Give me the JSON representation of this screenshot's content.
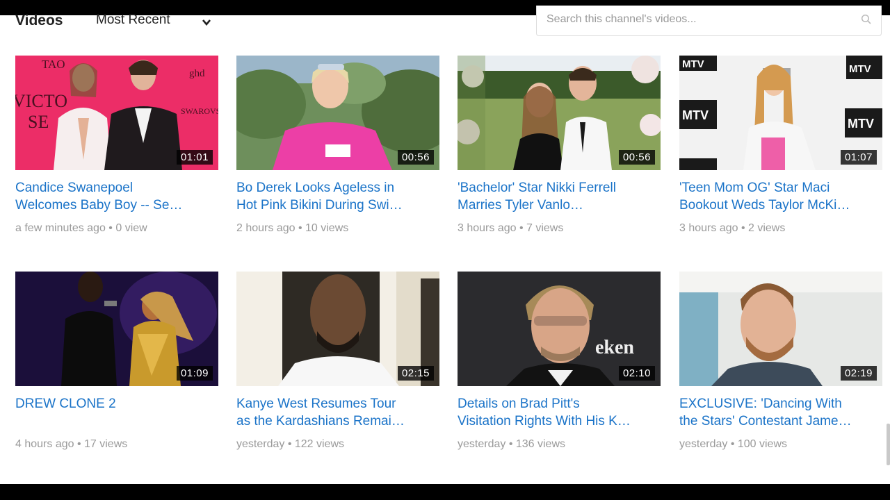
{
  "header": {
    "section_title": "Videos",
    "sort_label": "Most Recent",
    "search_placeholder": "Search this channel's videos..."
  },
  "videos": [
    {
      "title_line1": "Candice Swanepoel",
      "title_line2": "Welcomes Baby Boy -- Se…",
      "meta": "a few minutes ago • 0 view",
      "duration": "01:01"
    },
    {
      "title_line1": "Bo Derek Looks Ageless in",
      "title_line2": "Hot Pink Bikini During Swi…",
      "meta": "2 hours ago • 10 views",
      "duration": "00:56"
    },
    {
      "title_line1": "'Bachelor' Star Nikki Ferrell",
      "title_line2": "Marries Tyler Vanlo…",
      "meta": "3 hours ago • 7 views",
      "duration": "00:56"
    },
    {
      "title_line1": "'Teen Mom OG' Star Maci",
      "title_line2": "Bookout Weds Taylor McKi…",
      "meta": "3 hours ago • 2 views",
      "duration": "01:07"
    },
    {
      "title_line1": "DREW CLONE 2",
      "title_line2": "",
      "meta": "4 hours ago • 17 views",
      "duration": "01:09"
    },
    {
      "title_line1": "Kanye West Resumes Tour",
      "title_line2": "as the Kardashians Remai…",
      "meta": "yesterday • 122 views",
      "duration": "02:15"
    },
    {
      "title_line1": "Details on Brad Pitt's",
      "title_line2": "Visitation Rights With His K…",
      "meta": "yesterday • 136 views",
      "duration": "02:10"
    },
    {
      "title_line1": "EXCLUSIVE: 'Dancing With",
      "title_line2": "the Stars' Contestant Jame…",
      "meta": "yesterday • 100 views",
      "duration": "02:19"
    }
  ],
  "thumb_text": {
    "t1_tao": "TAO",
    "t1_victoria": "VICTO",
    "t1_secret": "SE",
    "t1_ghd": "ghd",
    "t1_swarovski": "SWAROVS",
    "t4_mtv": "MTV",
    "t7_heineken": "eken"
  },
  "colors": {
    "link": "#1a73c8",
    "meta": "#9a9a9a",
    "overlay": "#000000"
  }
}
